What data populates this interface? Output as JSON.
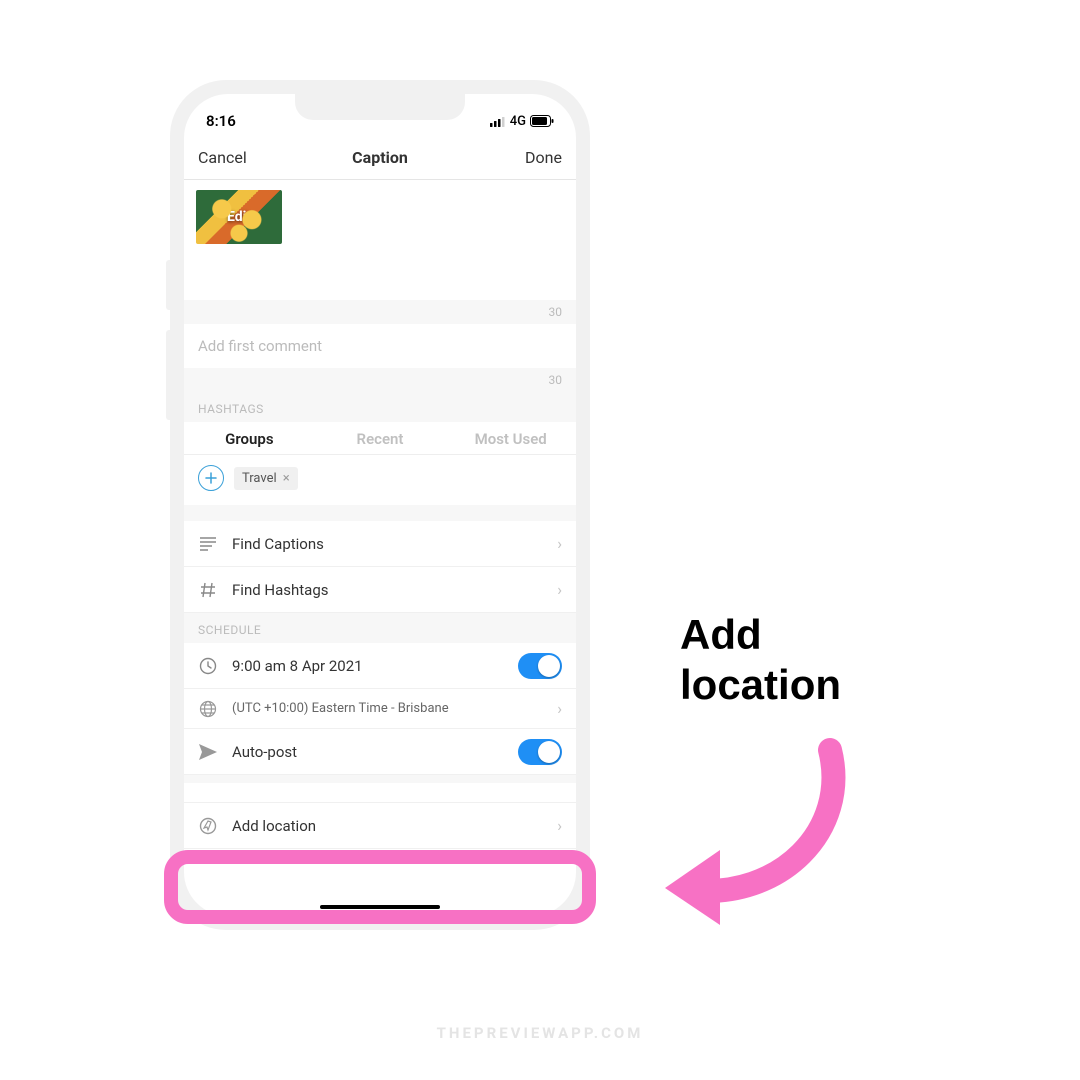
{
  "status": {
    "time": "8:16",
    "net": "4G"
  },
  "nav": {
    "cancel": "Cancel",
    "title": "Caption",
    "done": "Done"
  },
  "thumb": {
    "edit": "Edit"
  },
  "counters": {
    "caption": "30",
    "comment": "30"
  },
  "comment_placeholder": "Add first comment",
  "sections": {
    "hashtags": "HASHTAGS",
    "schedule": "SCHEDULE"
  },
  "tabs": {
    "groups": "Groups",
    "recent": "Recent",
    "most_used": "Most Used"
  },
  "chips": {
    "travel": "Travel"
  },
  "rows": {
    "find_captions": "Find Captions",
    "find_hashtags": "Find Hashtags",
    "schedule_time": "9:00 am  8 Apr 2021",
    "timezone": "(UTC +10:00) Eastern Time - Brisbane",
    "autopost": "Auto-post",
    "add_location": "Add location"
  },
  "callout": {
    "line1": "Add",
    "line2": "location"
  },
  "watermark": "THEPREVIEWAPP.COM"
}
